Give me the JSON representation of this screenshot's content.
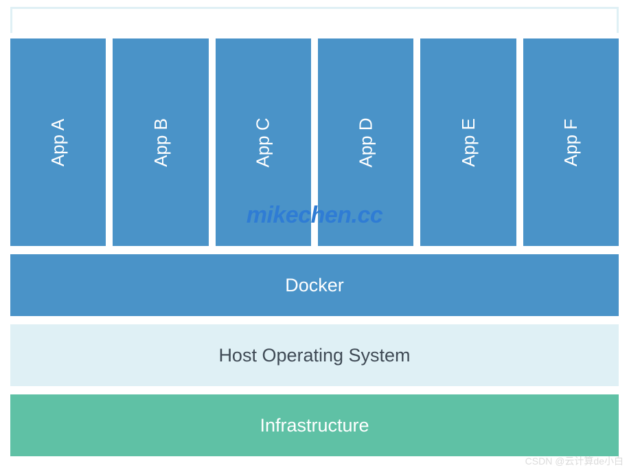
{
  "apps": [
    {
      "label": "App A"
    },
    {
      "label": "App B"
    },
    {
      "label": "App C"
    },
    {
      "label": "App D"
    },
    {
      "label": "App E"
    },
    {
      "label": "App F"
    }
  ],
  "layers": {
    "docker": "Docker",
    "host_os": "Host Operating System",
    "infrastructure": "Infrastructure"
  },
  "watermark_center": "mikechen.cc",
  "watermark_bottom": "CSDN @云计算de小白",
  "colors": {
    "blue": "#4a93c8",
    "lightblue": "#dff0f5",
    "green": "#5fc1a5",
    "wm_blue": "#2f7cd4"
  }
}
